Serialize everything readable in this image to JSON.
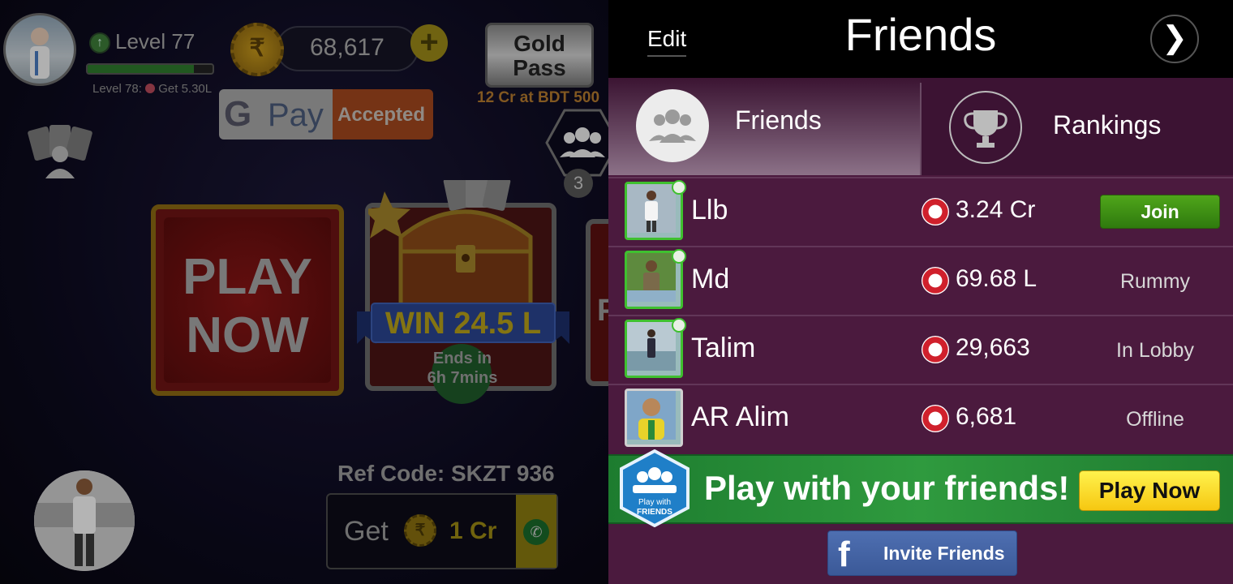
{
  "lobby": {
    "level_label": "Level 77",
    "level_progress": 0.85,
    "next_level_text_a": "Level 78:",
    "next_level_text_b": "Get 5.30L",
    "coins": "68,617",
    "coin_symbol": "₹",
    "plus_label": "+",
    "gpay_g": "G",
    "gpay_pay": "Pay",
    "gpay_accepted": "Accepted",
    "goldpass_line1": "Gold",
    "goldpass_line2": "Pass",
    "goldpass_offer": "12 Cr at BDT 500",
    "friends_count": "3",
    "play_now_line1": "PLAY",
    "play_now_line2": "NOW",
    "win_text": "WIN 24.5 L",
    "ends_line1": "Ends in",
    "ends_line2": "6h  7mins",
    "next_card_letter": "P",
    "ref_code": "Ref Code: SKZT 936",
    "get_label": "Get",
    "get_value": "1 Cr"
  },
  "panel": {
    "edit_label": "Edit",
    "title": "Friends",
    "next_glyph": "❯",
    "tabs": [
      {
        "label": "Friends",
        "active": true
      },
      {
        "label": "Rankings",
        "active": false
      }
    ],
    "friends": [
      {
        "name": "Llb",
        "chips": "3.24 Cr",
        "status": "Join",
        "online": true
      },
      {
        "name": "Md",
        "chips": "69.68 L",
        "status": "Rummy",
        "online": true
      },
      {
        "name": "Talim",
        "chips": "29,663",
        "status": "In Lobby",
        "online": true
      },
      {
        "name": "AR Alim",
        "chips": "6,681",
        "status": "Offline",
        "online": false
      }
    ],
    "banner": {
      "badge_text_1": "Play with",
      "badge_text_2": "FRIENDS",
      "text": "Play with your friends!",
      "button": "Play Now"
    },
    "invite": {
      "icon": "f",
      "label": "Invite Friends"
    }
  },
  "colors": {
    "panel_bg": "#4b1a3e",
    "join_green": "#3f8f16",
    "banner_green": "#2f9a3e",
    "play_yellow": "#f6c711",
    "facebook_blue": "#3b5998",
    "online_green": "#3fc02f"
  }
}
